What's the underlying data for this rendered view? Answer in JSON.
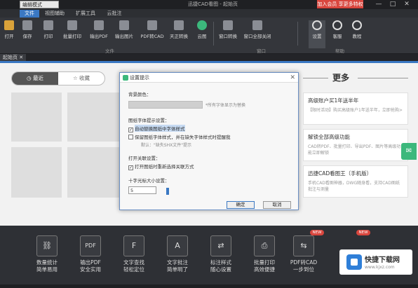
{
  "titlebar": {
    "mode": "编辑模式",
    "title": "迅捷CAD看图 - 起始页",
    "promo": "加入会员 享更多特权",
    "minimize": "—",
    "maximize": "□",
    "close": "✕"
  },
  "menu": [
    "文件",
    "视图辅助",
    "扩展工具",
    "云批注"
  ],
  "toolbar": {
    "items": [
      "打开",
      "保存",
      "打印",
      "批量打印",
      "输出PDF",
      "输出图片",
      "PDF转CAD",
      "天正转换",
      "云图",
      "窗口转换",
      "窗口全部关闭",
      "设置",
      "客服",
      "教程"
    ],
    "groups": [
      "文件",
      "窗口",
      "帮助"
    ]
  },
  "tabs": {
    "start": "起始页",
    "close": "✕"
  },
  "home": {
    "recent": "最近",
    "favorites": "收藏",
    "more": "更多",
    "cards": [
      {
        "title": "高级账户买1年送半年",
        "desc": "【限时活动】购买高级账户1年送半年，立即抢购>"
      },
      {
        "title": "解锁全部高级功能",
        "desc": "CAD转PDF、批量打印、导出PDF、图片等高级功能立即解锁"
      },
      {
        "title": "迅捷CAD看图王（手机版）",
        "desc": "手机CAD看图神器，DWG随身看，支持CAD图纸批注与测量"
      }
    ]
  },
  "dialog": {
    "title": "设置提示",
    "close": "✕",
    "bg_color_label": "背景颜色：",
    "bg_color_hint": "*所有字体显示为替换",
    "missing_font_section": "图纸字体提示设置：",
    "opt_auto_replace": "自动替换图纸中字体样式",
    "opt_keep_font": "保留图纸字体样式，并在缺失字体样式时提醒我",
    "opt_keep_font_hint": "默认：\"缺失SHX文件\"提示",
    "open_section": "打开关联设置：",
    "opt_open_last": "打开图纸时重新选择关联方式",
    "cursor_section": "十字光标大小设置：",
    "cursor_size": "5",
    "ok": "确定",
    "cancel": "取消"
  },
  "features": [
    {
      "line1": "数量统计",
      "line2": "简单易用",
      "icon": "⛓"
    },
    {
      "line1": "输出PDF",
      "line2": "安全实用",
      "icon": "PDF"
    },
    {
      "line1": "文字查找",
      "line2": "轻松定位",
      "icon": "F"
    },
    {
      "line1": "文字批注",
      "line2": "简单明了",
      "icon": "A"
    },
    {
      "line1": "标注样式",
      "line2": "随心设置",
      "icon": "⇄"
    },
    {
      "line1": "批量打印",
      "line2": "高效便捷",
      "icon": "⎙"
    },
    {
      "line1": "PDF转CAD",
      "line2": "一步到位",
      "icon": "⇆"
    }
  ],
  "new_badge": "NEW",
  "watermark": {
    "title": "快捷下载网",
    "sub": "www.kjxz.com"
  },
  "colors": {
    "accent": "#3a78c3",
    "brand_green": "#3cb87c",
    "promo_red": "#d9463e"
  }
}
